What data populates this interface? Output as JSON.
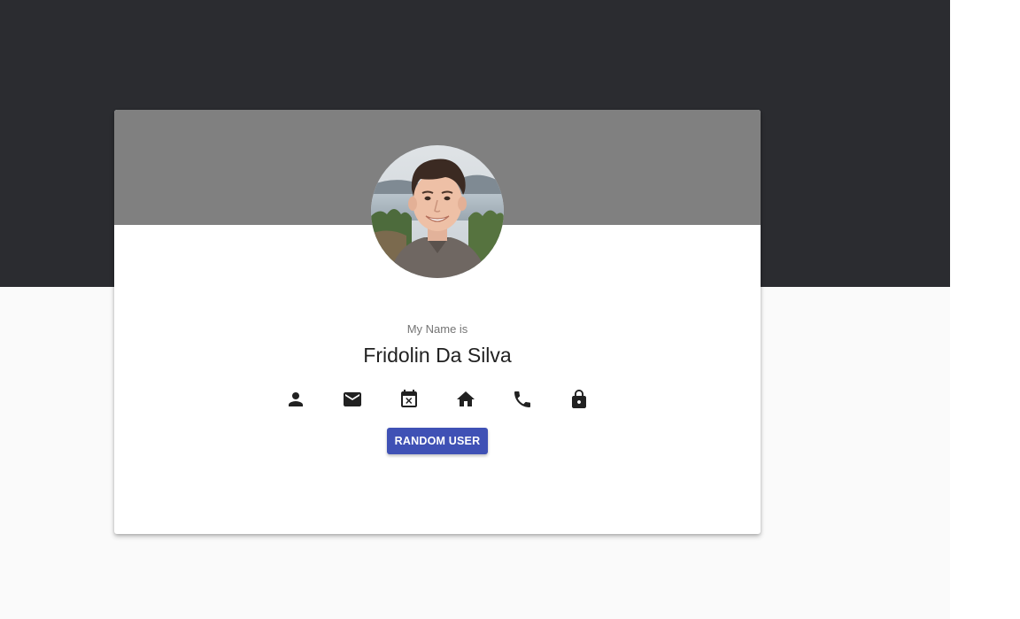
{
  "profile": {
    "caption": "My Name is",
    "name": "Fridolin Da Silva",
    "avatar_alt": "profile photo"
  },
  "icons": [
    {
      "name": "person-icon"
    },
    {
      "name": "email-icon"
    },
    {
      "name": "calendar-icon"
    },
    {
      "name": "home-icon"
    },
    {
      "name": "phone-icon"
    },
    {
      "name": "lock-icon"
    }
  ],
  "actions": {
    "random_label": "RANDOM USER"
  },
  "colors": {
    "hero_background": "#2b2c30",
    "card_header": "#808080",
    "page_background": "#fafafa",
    "button": "#3f51b5",
    "icon": "#212121"
  }
}
